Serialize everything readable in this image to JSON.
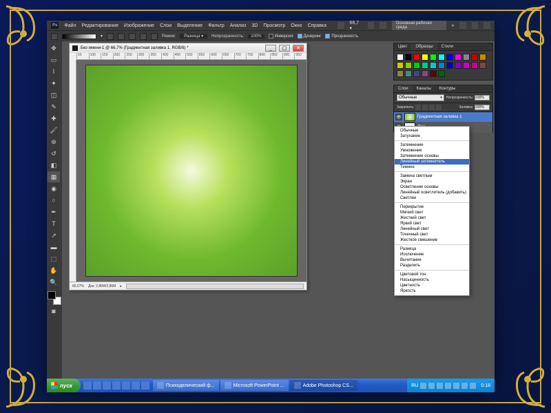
{
  "menubar": {
    "logo": "Ps",
    "items": [
      "Файл",
      "Редактирование",
      "Изображение",
      "Слои",
      "Выделение",
      "Фильтр",
      "Анализ",
      "3D",
      "Просмотр",
      "Окно",
      "Справка"
    ],
    "zoom": "66,7",
    "workspace": "Основная рабочая среда"
  },
  "options": {
    "mode_label": "Режим:",
    "mode_value": "Разница",
    "opacity_label": "Непрозрачность:",
    "opacity_value": "100%",
    "chk_inverse": "Инверсия",
    "chk_dither": "Дизеринг",
    "chk_trans": "Прозрачность"
  },
  "doc": {
    "title": "Без имени-1 @ 66,7% (Градиентная заливка 1, RGB/8) *",
    "ruler_marks": [
      "50",
      "100",
      "150",
      "200",
      "250",
      "300",
      "350",
      "400",
      "450",
      "500",
      "550",
      "600",
      "650",
      "700",
      "750",
      "800",
      "850",
      "900",
      "950"
    ],
    "status_zoom": "66,67%",
    "status_doc": "Док: 2,86M/2,86M"
  },
  "swatches_panel": {
    "tabs": [
      "Цвет",
      "Образцы",
      "Стили"
    ],
    "colors": [
      "#fff",
      "#000",
      "#f00",
      "#ff0",
      "#0f0",
      "#0ff",
      "#00f",
      "#f0f",
      "#888",
      "#c00",
      "#c80",
      "#cc0",
      "#8c0",
      "#0c0",
      "#0c8",
      "#0cc",
      "#08c",
      "#00c",
      "#80c",
      "#c0c",
      "#c08",
      "#844",
      "#884",
      "#488",
      "#448",
      "#848",
      "#600",
      "#060"
    ]
  },
  "layers_panel": {
    "tabs": [
      "Слои",
      "Каналы",
      "Контуры"
    ],
    "blend_selected": "Обычные",
    "opacity_label": "Непрозрачность:",
    "opacity_value": "100%",
    "fill_label": "Заливка:",
    "fill_value": "100%",
    "lock_label": "Закрепить:",
    "layers": [
      {
        "name": "Градиентная заливка 1",
        "selected": true
      },
      {
        "name": "Фон",
        "selected": false
      }
    ]
  },
  "blend_modes": {
    "highlighted": "Линейный затемнитель",
    "groups": [
      [
        "Обычные",
        "Затухание"
      ],
      [
        "Затемнение",
        "Умножение",
        "Затемнение основы",
        "Линейный затемнитель",
        "Темнее"
      ],
      [
        "Замена светлым",
        "Экран",
        "Осветление основы",
        "Линейный осветлитель (добавить)",
        "Светлее"
      ],
      [
        "Перекрытие",
        "Мягкий свет",
        "Жесткий свет",
        "Яркий свет",
        "Линейный свет",
        "Точечный свет",
        "Жесткое смешение"
      ],
      [
        "Разница",
        "Исключение",
        "Вычитание",
        "Разделить"
      ],
      [
        "Цветовой тон",
        "Насыщенность",
        "Цветность",
        "Яркость"
      ]
    ]
  },
  "taskbar": {
    "start": "пуск",
    "tasks": [
      {
        "label": "Психоделический ф...",
        "active": false
      },
      {
        "label": "Microsoft PowerPoint ...",
        "active": false
      },
      {
        "label": "Adobe Photoshop CS...",
        "active": true
      }
    ],
    "lang": "RU",
    "time": "0:18"
  }
}
